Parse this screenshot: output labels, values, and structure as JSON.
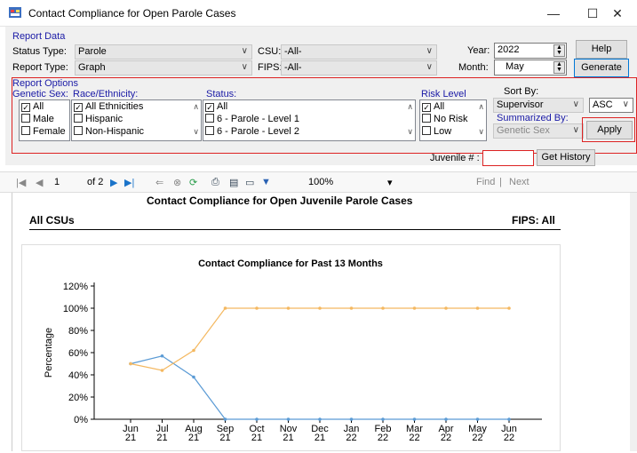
{
  "window": {
    "title": "Contact Compliance for Open Parole Cases",
    "minimize": "—",
    "maximize": "☐",
    "close": "✕"
  },
  "report_data": {
    "group_label": "Report Data",
    "status_type_label": "Status Type:",
    "status_type_value": "Parole",
    "report_type_label": "Report Type:",
    "report_type_value": "Graph",
    "csu_label": "CSU:",
    "csu_value": "-All-",
    "fips_label": "FIPS:",
    "fips_value": "-All-",
    "year_label": "Year:",
    "year_value": "2022",
    "month_label": "Month:",
    "month_value": "May",
    "help_label": "Help",
    "generate_label": "Generate"
  },
  "report_options": {
    "group_label": "Report Options",
    "genetic_sex_label": "Genetic Sex:",
    "genetic_sex_items": [
      {
        "label": "All",
        "checked": true
      },
      {
        "label": "Male",
        "checked": false
      },
      {
        "label": "Female",
        "checked": false
      }
    ],
    "race_label": "Race/Ethnicity:",
    "race_items": [
      {
        "label": "All Ethnicities",
        "checked": true
      },
      {
        "label": "Hispanic",
        "checked": false
      },
      {
        "label": "Non-Hispanic",
        "checked": false
      }
    ],
    "status_label": "Status:",
    "status_items": [
      {
        "label": "All",
        "checked": true
      },
      {
        "label": "6 - Parole - Level 1",
        "checked": false
      },
      {
        "label": "6 - Parole - Level 2",
        "checked": false
      }
    ],
    "risk_label": "Risk Level",
    "risk_items": [
      {
        "label": "All",
        "checked": true
      },
      {
        "label": "No Risk",
        "checked": false
      },
      {
        "label": "Low",
        "checked": false
      }
    ],
    "sort_by_label": "Sort By:",
    "sort_by_value": "Supervisor",
    "sort_dir_value": "ASC",
    "summarized_by_label": "Summarized By:",
    "summarized_by_value": "Genetic Sex",
    "apply_label": "Apply",
    "juvenile_label": "Juvenile # :",
    "juvenile_value": "",
    "get_history_label": "Get History"
  },
  "viewer": {
    "page_current": "1",
    "page_of": "of 2",
    "zoom": "100%",
    "find_label": "Find",
    "next_label": "Next"
  },
  "report": {
    "title": "Contact Compliance for Open Juvenile Parole  Cases",
    "csu_header": "All CSUs",
    "fips_header": "FIPS: All"
  },
  "colors": {
    "series_blue": "#5b9bd5",
    "series_orange": "#f4b860",
    "highlight_red": "#d22222"
  },
  "chart_data": {
    "type": "line",
    "title": "Contact Compliance for Past 13 Months",
    "ylabel": "Percentage",
    "xlabel": "",
    "ylim": [
      0,
      120
    ],
    "y_ticks": [
      "0%",
      "20%",
      "40%",
      "60%",
      "80%",
      "100%",
      "120%"
    ],
    "y_tick_values": [
      0,
      20,
      40,
      60,
      80,
      100,
      120
    ],
    "categories": [
      [
        "Jun",
        "21"
      ],
      [
        "Jul",
        "21"
      ],
      [
        "Aug",
        "21"
      ],
      [
        "Sep",
        "21"
      ],
      [
        "Oct",
        "21"
      ],
      [
        "Nov",
        "21"
      ],
      [
        "Dec",
        "21"
      ],
      [
        "Jan",
        "22"
      ],
      [
        "Feb",
        "22"
      ],
      [
        "Mar",
        "22"
      ],
      [
        "Apr",
        "22"
      ],
      [
        "May",
        "22"
      ],
      [
        "Jun",
        "22"
      ]
    ],
    "series": [
      {
        "color": "#5b9bd5",
        "values": [
          50,
          57,
          38,
          0,
          0,
          0,
          0,
          0,
          0,
          0,
          0,
          0,
          0
        ]
      },
      {
        "color": "#f4b860",
        "values": [
          50,
          44,
          62,
          100,
          100,
          100,
          100,
          100,
          100,
          100,
          100,
          100,
          100
        ]
      }
    ],
    "grid": false,
    "legend": "none"
  }
}
